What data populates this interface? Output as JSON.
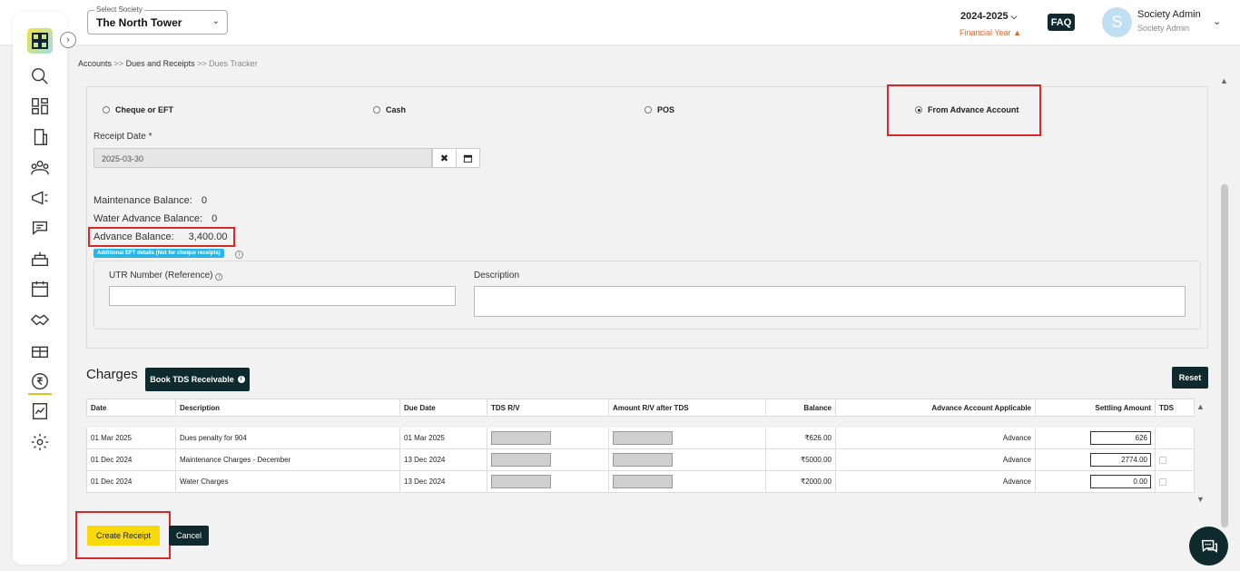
{
  "header": {
    "society_label": "Select Society",
    "society_value": "The North Tower",
    "financial_year": "2024-2025",
    "financial_year_label": "Financial Year",
    "faq": "FAQ",
    "avatar_letter": "S",
    "user_name": "Society Admin",
    "user_role": "Society Admin"
  },
  "breadcrumb": {
    "items": [
      "Accounts",
      "Dues and Receipts",
      "Dues Tracker"
    ],
    "separator": ">>"
  },
  "payment": {
    "options": [
      "Cheque or EFT",
      "Cash",
      "POS",
      "From Advance Account"
    ],
    "selected": "From Advance Account"
  },
  "receipt": {
    "date_label": "Receipt Date *",
    "date_value": "2025-03-30"
  },
  "balances": {
    "maintenance_label": "Maintenance Balance:",
    "maintenance_value": "0",
    "water_label": "Water Advance Balance:",
    "water_value": "0",
    "advance_label": "Advance Balance:",
    "advance_value": "3,400.00"
  },
  "eft": {
    "tag": "Additional EFT details (Not for cheque receipts)",
    "utr_label": "UTR Number (Reference)",
    "description_label": "Description"
  },
  "charges": {
    "title": "Charges",
    "tds_button": "Book TDS Receivable",
    "reset_button": "Reset",
    "headers": [
      "Date",
      "Description",
      "Due Date",
      "TDS R/V",
      "Amount R/V after TDS",
      "Balance",
      "Advance Account Applicable",
      "Settling Amount",
      "TDS"
    ],
    "rows": [
      {
        "date": "01 Mar 2025",
        "description": "Dues penalty for 904",
        "due_date": "01 Mar 2025",
        "balance": "₹626.00",
        "advance": "Advance",
        "settling": "626",
        "tds": false
      },
      {
        "date": "01 Dec 2024",
        "description": "Maintenance Charges - December",
        "due_date": "13 Dec 2024",
        "balance": "₹5000.00",
        "advance": "Advance",
        "settling": "2774.00",
        "tds": true
      },
      {
        "date": "01 Dec 2024",
        "description": "Water Charges",
        "due_date": "13 Dec 2024",
        "balance": "₹2000.00",
        "advance": "Advance",
        "settling": "0.00",
        "tds": true
      }
    ]
  },
  "actions": {
    "create": "Create Receipt",
    "cancel": "Cancel"
  },
  "colors": {
    "dark": "#0f2a2e",
    "accent": "#f7d90a",
    "highlight": "#d62a2a",
    "warning": "#e2672f"
  }
}
